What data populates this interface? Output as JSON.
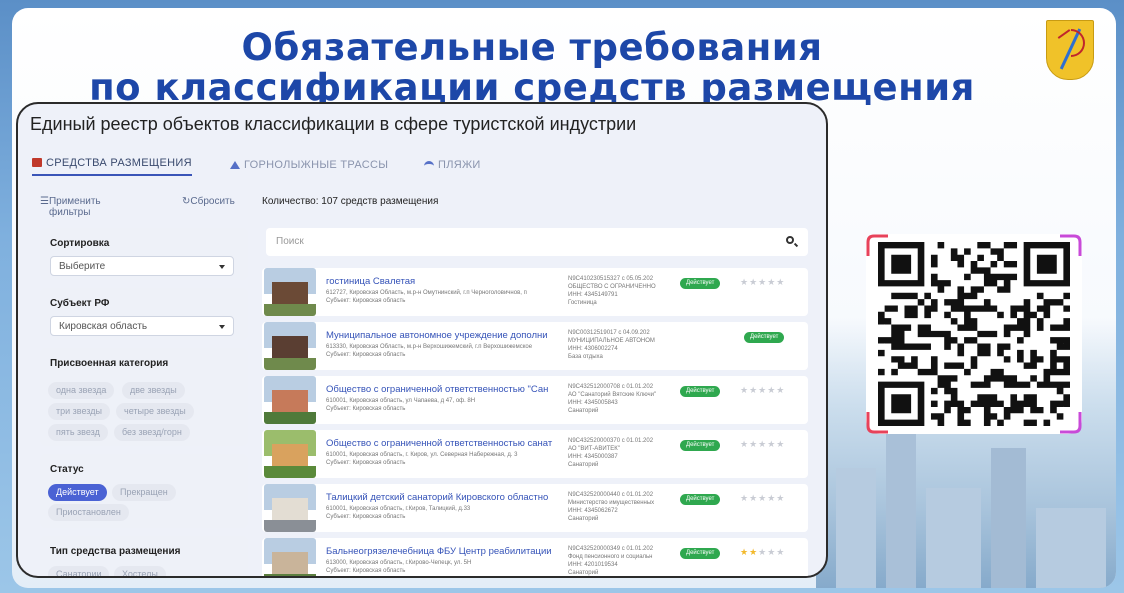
{
  "slide": {
    "title_line1": "Обязательные требования",
    "title_line2": "по классификации средств размещения"
  },
  "panel": {
    "title": "Единый реестр объектов классификации в сфере туристской индустрии",
    "tabs": [
      {
        "label": "СРЕДСТВА РАЗМЕЩЕНИЯ",
        "active": true,
        "icon": "hotel-icon"
      },
      {
        "label": "ГОРНОЛЫЖНЫЕ ТРАССЫ",
        "active": false,
        "icon": "mountain-icon"
      },
      {
        "label": "ПЛЯЖИ",
        "active": false,
        "icon": "beach-icon"
      }
    ],
    "toolbar": {
      "apply_filters": "Применить фильтры",
      "reset": "Сбросить",
      "count": "Количество: 107 средств размещения"
    },
    "filters": {
      "sort_label": "Сортировка",
      "sort_value": "Выберите",
      "region_label": "Субъект РФ",
      "region_value": "Кировская область",
      "category_label": "Присвоенная категория",
      "categories": [
        "одна звезда",
        "две звезды",
        "три звезды",
        "четыре звезды",
        "пять звезд",
        "без звезд/горн"
      ],
      "status_label": "Статус",
      "statuses": [
        "Действует",
        "Прекращен",
        "Приостановлен"
      ],
      "type_label": "Тип средства размещения",
      "types": [
        "Санатории",
        "Хостелы"
      ]
    },
    "search_placeholder": "Поиск",
    "results": [
      {
        "name": "гостиница Свалетая",
        "address": "612727, Кировская Область, м.р-н Омутнинский, г.п Черноголовичнов, п",
        "subject": "Субъект: Кировская область",
        "info": [
          "N9C410230515327 с 05.05.202",
          "ОБЩЕСТВО С ОГРАНИЧЕННО",
          "ИНН: 4345149791",
          "Гостиница"
        ],
        "status": "Действует",
        "stars": 0
      },
      {
        "name": "Муниципальное автономное учреждение дополни",
        "address": "613330, Кировская Область, м.р-н Верхошижемский, г.п Верхошижемское",
        "subject": "Субъект: Кировская область",
        "info": [
          "N9C00312519017 с 04.09.202",
          "МУНИЦИПАЛЬНОЕ АВТОНОМ",
          "ИНН: 4306002274",
          "База отдыха"
        ],
        "status": "Действует",
        "stars": null
      },
      {
        "name": "Общество с ограниченной ответственностью \"Сан",
        "address": "610001, Кировская область, ул Чапаева, д 47, оф. 8Н",
        "subject": "Субъект: Кировская область",
        "info": [
          "N9C432512000708 с 01.01.202",
          "АО \"Санаторий Вятские Ключи\"",
          "ИНН: 4345005843",
          "Санаторий"
        ],
        "status": "Действует",
        "stars": 0
      },
      {
        "name": "Общество с ограниченной ответственностью санат",
        "address": "610001, Кировская область, г. Киров, ул. Северная Набережная, д. 3",
        "subject": "Субъект: Кировская область",
        "info": [
          "N9C432520000370 с 01.01.202",
          "АО \"ВИТ-АВИТЕК\"",
          "ИНН: 4345000387",
          "Санаторий"
        ],
        "status": "Действует",
        "stars": 0
      },
      {
        "name": "Талицкий детский санаторий Кировского областно",
        "address": "610001, Кировская область, г.Киров, Талицкий, д.33",
        "subject": "Субъект: Кировская область",
        "info": [
          "N9C432520000440 с 01.01.202",
          "Министерство имущественных",
          "ИНН: 4345062672",
          "Санаторий"
        ],
        "status": "Действует",
        "stars": 0
      },
      {
        "name": "Бальнеогрязелечебница ФБУ Центр реабилитации",
        "address": "613000, Кировская область, г.Кирово-Чепецк, ул. 5Н",
        "subject": "Субъект: Кировская область",
        "info": [
          "N9C432520000349 с 01.01.202",
          "Фонд пенсионного и социальн",
          "ИНН: 4201019534",
          "Санаторий"
        ],
        "status": "Действует",
        "stars": 2
      }
    ]
  },
  "colors": {
    "title_blue": "#1d47a8",
    "status_green": "#2fa84f",
    "chip_active": "#4a62d4",
    "link_blue": "#3553b8",
    "star_gold": "#f2b92c"
  }
}
